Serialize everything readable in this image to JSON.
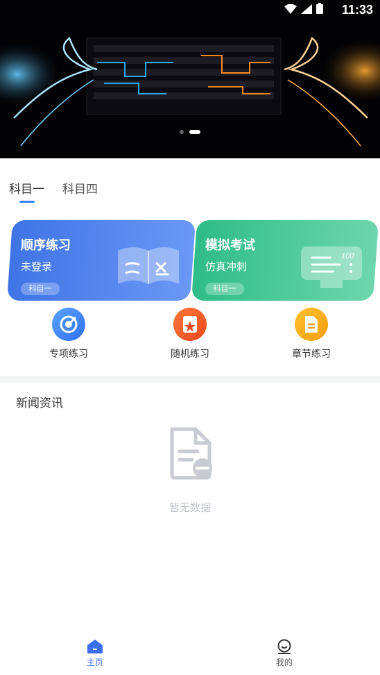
{
  "status_bar": {
    "time": "11:33"
  },
  "tabs": [
    {
      "label": "科目一"
    },
    {
      "label": "科目四"
    }
  ],
  "cards": [
    {
      "title": "顺序练习",
      "subtitle": "未登录",
      "tag": "科目一"
    },
    {
      "title": "模拟考试",
      "subtitle": "仿真冲刺",
      "tag": "科目一",
      "art_text": "100"
    }
  ],
  "practice_icons": [
    {
      "label": "专项练习",
      "color": "#3b82f6"
    },
    {
      "label": "随机练习",
      "color": "#f05a2a"
    },
    {
      "label": "章节练习",
      "color": "#f59e0b"
    }
  ],
  "news": {
    "title": "新闻资讯",
    "empty_text": "暂无数据"
  },
  "bottom_nav": [
    {
      "label": "主页",
      "active": true
    },
    {
      "label": "我的",
      "active": false
    }
  ],
  "colors": {
    "accent": "#3b82f6",
    "blue_card": "#4f7ef0",
    "green_card": "#3ec995"
  }
}
